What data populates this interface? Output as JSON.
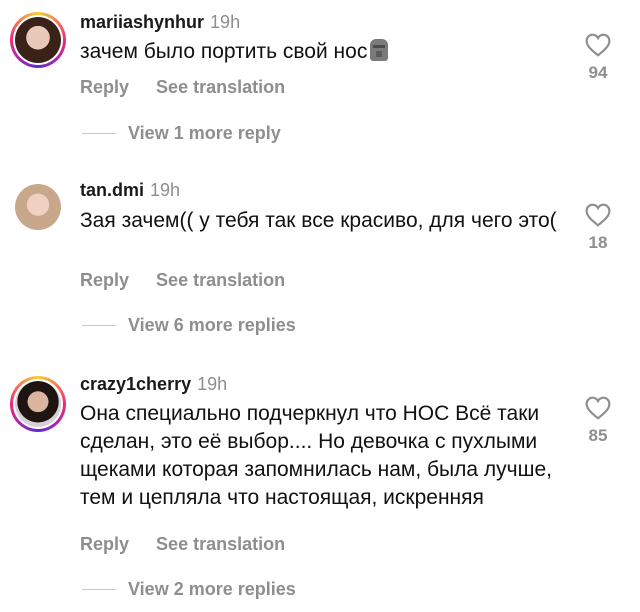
{
  "comments": [
    {
      "username": "mariiashynhur",
      "time": "19h",
      "text": "зачем было портить свой нос",
      "emoji": "moai",
      "reply_label": "Reply",
      "translate_label": "See translation",
      "like_count": "94",
      "view_more": "View 1 more reply"
    },
    {
      "username": "tan.dmi",
      "time": "19h",
      "text": "Зая зачем(( у тебя так все красиво, для чего это(",
      "reply_label": "Reply",
      "translate_label": "See translation",
      "like_count": "18",
      "view_more": "View 6 more replies"
    },
    {
      "username": "crazy1cherry",
      "time": "19h",
      "text": "Она специально подчеркнул что НОС Всё таки сделан, это её выбор.... Но девочка с пухлыми щеками которая запомнилась нам, была лучше, тем и цепляла что настоящая, искренняя",
      "reply_label": "Reply",
      "translate_label": "See translation",
      "like_count": "85",
      "view_more": "View 2 more replies"
    }
  ],
  "icons": {
    "heart": "heart-outline-icon"
  },
  "colors": {
    "muted": "#8e8e8e",
    "text": "#111111",
    "story_ring": "#ee2a7b"
  }
}
